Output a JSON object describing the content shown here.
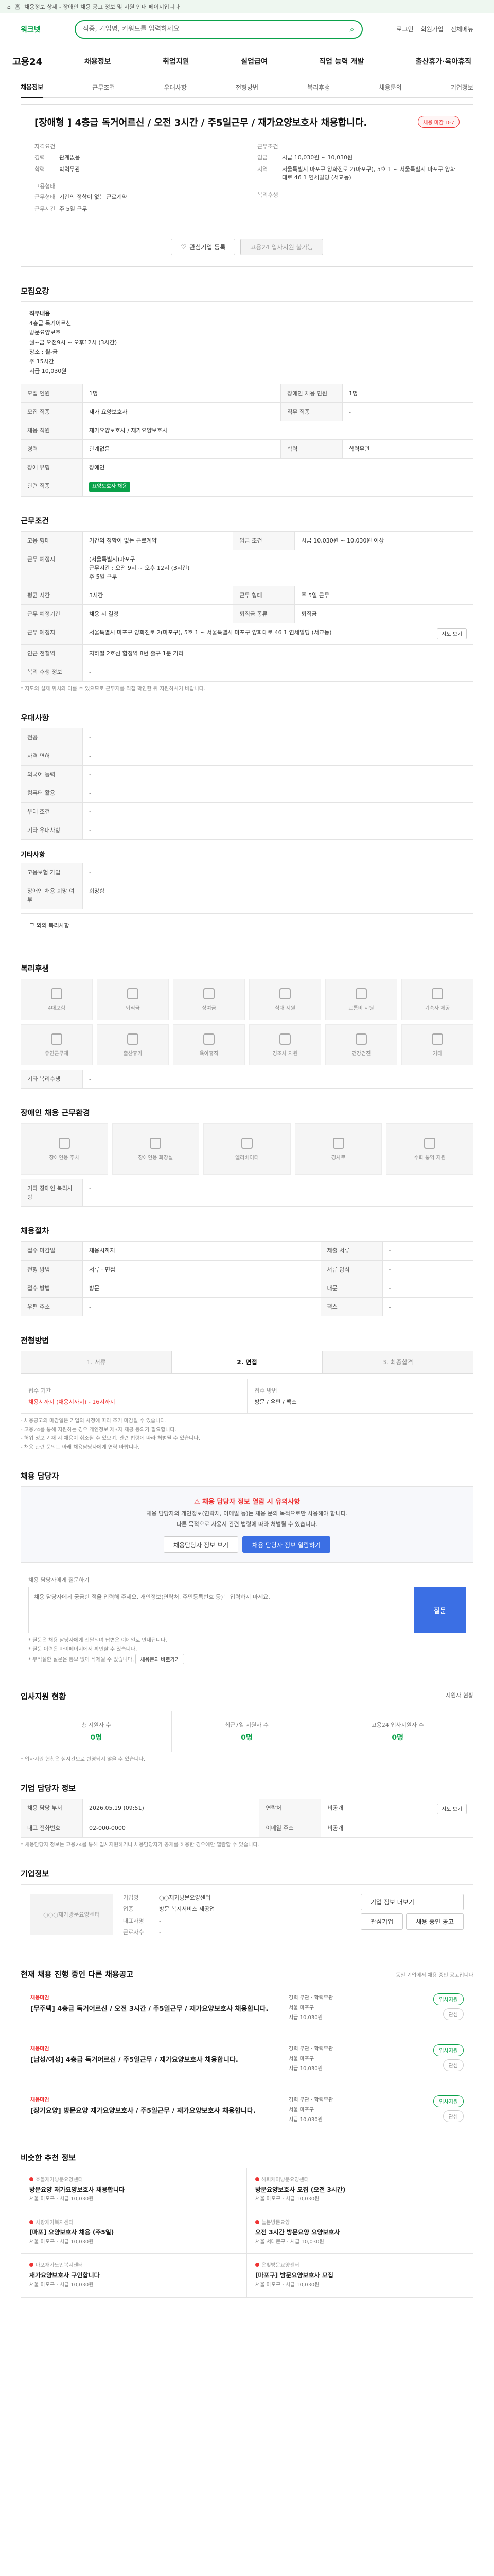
{
  "topstrip": {
    "home": "홈",
    "text": "채용정보 상세 - 장애인 채용 공고 정보 및 지원 안내 페이지입니다"
  },
  "header": {
    "logo": "워크넷",
    "search_placeholder": "직종, 기업명, 키워드를 입력하세요",
    "login": "로그인",
    "join": "회원가입",
    "menu_all": "전체메뉴"
  },
  "gnb": {
    "brand": "고용24",
    "items": [
      "채용정보",
      "취업지원",
      "실업급여",
      "직업 능력 개발",
      "출산휴가·육아휴직"
    ]
  },
  "tabs": {
    "items": [
      "채용정보",
      "근무조건",
      "우대사항",
      "전형방법",
      "복리후생",
      "채용문의",
      "기업정보"
    ]
  },
  "summary": {
    "title": "[장애형 ] 4층급 독거어르신 / 오전 3시간 / 주5일근무 / 재가요양보호사 채용합니다.",
    "badge": "채용 마감 D-7",
    "left_label": "자격요건",
    "left": [
      {
        "k": "경력",
        "v": "관계없음"
      },
      {
        "k": "학력",
        "v": "학력무관"
      }
    ],
    "left_label2": "고용형태",
    "left2": [
      {
        "k": "근무형태",
        "v": "기간의 정함이 없는 근로계약"
      },
      {
        "k": "근무시간",
        "v": "주 5일 근무"
      }
    ],
    "right_label": "근무조건",
    "right": [
      {
        "k": "임금",
        "v": "시급 10,030원 ~ 10,030원"
      },
      {
        "k": "지역",
        "v": "서울특별시 마포구 양화진로 2(마포구), 5호 1 ~ 서울특별시 마포구 양화대로 46 1 연세빌딩 (서교동)"
      }
    ],
    "right_label2": "복리후생",
    "btn_interest": "관심기업 등록",
    "btn_apply": "고용24 입사지원 불가능"
  },
  "recruit": {
    "h": "모집요강",
    "duty_label": "직무내용",
    "duty": "4층급 독거어르신\n방문요양보호\n월~금 오전9시 ~ 오후12시 (3시간)\n장소 : 월-금\n주 15시간\n시급 10,030원",
    "rows": [
      {
        "k1": "모집 인원",
        "v1": "1명",
        "k2": "장애인 채용 인원",
        "v2": "1명"
      },
      {
        "k1": "모집 직종",
        "v1": "재가 요양보호사",
        "k2": "직무 직종",
        "v2": "-"
      },
      {
        "k1": "채용 직원",
        "v1": "재가요양보호사 / 재가요양보호사",
        "k2": "",
        "v2": ""
      },
      {
        "k1": "경력",
        "v1": "관계없음",
        "k2": "학력",
        "v2": "학력무관"
      },
      {
        "k1": "장애 유형",
        "v1": "장애인",
        "k2": "",
        "v2": ""
      }
    ],
    "keyword_label": "관련 직종",
    "keyword": "요양보호사 채용"
  },
  "work": {
    "h": "근무조건",
    "rows": [
      {
        "k1": "고용 형태",
        "v1": "기간의 정함이 없는 근로계약",
        "k2": "임금 조건",
        "v2": "시급 10,030원 ~ 10,030원 이상"
      },
      {
        "k1": "근무 예정지",
        "v1": "(서울특별시)마포구\n근무시간 : 오전 9시 ~ 오후 12시 (3시간)\n주 5일 근무",
        "k2": "",
        "v2": ""
      },
      {
        "k1": "평균 시간",
        "v1": "3시간",
        "k2": "근무 형태",
        "v2": "주 5일 근무"
      },
      {
        "k1": "근무 예정기간",
        "v1": "채용 시 결정",
        "k2": "퇴직금 종류",
        "v2": "퇴직금"
      },
      {
        "k1": "근무 예정지",
        "v1": "서울특별시 마포구 양화진로 2(마포구), 5호 1 ~ 서울특별시 마포구 양화대로 46 1 연세빌딩 (서교동)",
        "k2": "",
        "v2": ""
      },
      {
        "k1": "인근 전철역",
        "v1": "지하철 2호선 합정역 8번 출구 1분 거리",
        "k2": "",
        "v2": ""
      },
      {
        "k1": "복리 후생 정보",
        "v1": "-",
        "k2": "",
        "v2": ""
      }
    ],
    "map_btn": "지도 보기",
    "note": "* 지도의 실제 위치와 다를 수 있으므로 근무지를 직접 확인한 뒤 지원하시기 바랍니다."
  },
  "prefer": {
    "h": "우대사항",
    "rows": [
      {
        "k": "전공",
        "v": "-"
      },
      {
        "k": "자격 면허",
        "v": "-"
      },
      {
        "k": "외국어 능력",
        "v": "-"
      },
      {
        "k": "컴퓨터 활용",
        "v": "-"
      },
      {
        "k": "우대 조건",
        "v": "-"
      },
      {
        "k": "기타 우대사항",
        "v": "-"
      }
    ],
    "etc_h": "기타사항",
    "etc": [
      {
        "k": "고용보험 가입",
        "v": "-"
      },
      {
        "k": "장애인 채용 희망 여부",
        "v": "희망함"
      }
    ],
    "etc_box": "그 외의 복리사항"
  },
  "welfare": {
    "h": "복리후생",
    "items": [
      "4대보험",
      "퇴직금",
      "상여금",
      "식대 지원",
      "교통비 지원",
      "기숙사 제공",
      "유연근무제",
      "출산휴가",
      "육아휴직",
      "경조사 지원",
      "건강검진",
      "기타"
    ],
    "etc_label": "기타 복리후생",
    "etc": "-"
  },
  "disability": {
    "h": "장애인 채용 근무환경",
    "items": [
      "장애인용 주차",
      "장애인용 화장실",
      "엘리베이터",
      "경사로",
      "수화 통역 지원"
    ],
    "etc_label": "기타 장애인 복리사항",
    "etc": "-"
  },
  "apply": {
    "h": "채용절차",
    "rows": [
      {
        "k1": "접수 마감일",
        "v1": "채용시까지",
        "k2": "제출 서류",
        "v2": "-"
      },
      {
        "k1": "전형 방법",
        "v1": "서류 · 면접",
        "k2": "서류 양식",
        "v2": "-"
      },
      {
        "k1": "접수 방법",
        "v1": "방문",
        "k2": "내문",
        "v2": "-"
      },
      {
        "k1": "우편 주소",
        "v1": "-",
        "k2": "팩스",
        "v2": "-"
      }
    ]
  },
  "process": {
    "h": "전형방법",
    "steps": [
      "1. 서류",
      "2. 면접",
      "3. 최종합격"
    ],
    "left_label": "접수 기간",
    "left_status": "채용시까지 (채용시까지) - 16시까지",
    "right_label": "접수 방법",
    "right_v": "방문 / 우편 / 팩스",
    "notes": [
      "- 채용공고의 마감일은 기업의 사정에 따라 조기 마감될 수 있습니다.",
      "- 고용24를 통해 지원하는 경우 개인정보 제3자 제공 동의가 필요합니다.",
      "- 허위 정보 기재 시 채용이 취소될 수 있으며, 관련 법령에 따라 처벌될 수 있습니다.",
      "- 채용 관련 문의는 아래 채용담당자에게 연락 바랍니다."
    ]
  },
  "inquiry": {
    "h": "채용 담당자",
    "warn": "채용 담당자 정보 열람 시 유의사항",
    "body": "채용 담당자의 개인정보(연락처, 이메일 등)는 채용 문의 목적으로만 사용해야 합니다.\n다른 목적으로 사용시 관련 법령에 따라 처벌될 수 있습니다.",
    "btn1": "채용담당자 정보 보기",
    "btn2": "채용 담당자 정보 열람하기",
    "form_label": "채용 담당자에게 질문하기",
    "form_placeholder": "채용 담당자에게 궁금한 점을 입력해 주세요. 개인정보(연락처, 주민등록번호 등)는 입력하지 마세요.",
    "send": "질문",
    "n1": "* 질문은 채용 담당자에게 전달되며 답변은 이메일로 안내됩니다.",
    "n2": "* 질문 이력은 마이페이지에서 확인할 수 있습니다.",
    "n3": "* 부적절한 질문은 통보 없이 삭제될 수 있습니다.",
    "inq_btn": "채용문의 바로가기"
  },
  "status": {
    "h": "입사지원 현황",
    "more": "지원자 현황",
    "items": [
      {
        "k": "총 지원자 수",
        "v": "0명"
      },
      {
        "k": "최근7일 지원자 수",
        "v": "0명"
      },
      {
        "k": "고용24 입사지원자 수",
        "v": "0명"
      }
    ],
    "note": "* 입사지원 현황은 실시간으로 반영되지 않을 수 있습니다."
  },
  "manager": {
    "h": "기업 담당자 정보",
    "rows": [
      {
        "k1": "채용 담당 부서",
        "v1": "2026.05.19 (09:51)",
        "k2": "연락처",
        "v2": "비공개"
      },
      {
        "k1": "대표 전화번호",
        "v1": "02-000-0000",
        "k2": "이메일 주소",
        "v2": "비공개"
      }
    ],
    "btn": "지도 보기",
    "note": "* 채용담당자 정보는 고용24를 통해 입사지원하거나 채용담당자가 공개를 허용한 경우에만 열람할 수 있습니다."
  },
  "company": {
    "h": "기업정보",
    "name": "○○○재가방문요양센터",
    "rows": [
      {
        "k": "기업명",
        "v": "○○재가방문요양센터"
      },
      {
        "k": "업종",
        "v": "방문 복지서비스 제공업"
      },
      {
        "k": "대표자명",
        "v": "-"
      },
      {
        "k": "근로자수",
        "v": "-"
      }
    ],
    "btn_more": "기업 정보 더보기",
    "btn_follow": "관심기업",
    "btn_jobs": "채용 중인 공고"
  },
  "joblist": {
    "h": "현재 채용 진행 중인 다른 채용공고",
    "note": "동일 기업에서 채용 중인 공고입니다",
    "items": [
      {
        "co": "채용마감",
        "t": "[무주택] 4층급 독거어르신 / 오전 3시간 / 주5일근무 / 재가요양보호사 채용합니다.",
        "m1": "경력 무관 · 학력무관",
        "m2": "서울 마포구",
        "m3": "시급 10,030원",
        "p1": "입사지원",
        "p2": "관심"
      },
      {
        "co": "채용마감",
        "t": "[남성/여성] 4층급 독거어르신 / 주5일근무 / 재가요양보호사 채용합니다.",
        "m1": "경력 무관 · 학력무관",
        "m2": "서울 마포구",
        "m3": "시급 10,030원",
        "p1": "입사지원",
        "p2": "관심"
      },
      {
        "co": "채용마감",
        "t": "[장기요양] 방문요양 재가요양보호사 / 주5일근무 / 재가요양보호사 채용합니다.",
        "m1": "경력 무관 · 학력무관",
        "m2": "서울 마포구",
        "m3": "시급 10,030원",
        "p1": "입사지원",
        "p2": "관심"
      }
    ]
  },
  "recommend": {
    "h": "비슷한 추천 정보",
    "items": [
      {
        "co": "효돌재가방문요양센터",
        "t": "방문요양 재가요양보호사 채용합니다",
        "d": "서울 마포구 · 시급 10,030원"
      },
      {
        "co": "해피케어방문요양센터",
        "t": "방문요양보호사 모집 (오전 3시간)",
        "d": "서울 마포구 · 시급 10,030원"
      },
      {
        "co": "사랑재가복지센터",
        "t": "[마포] 요양보호사 채용 (주5일)",
        "d": "서울 마포구 · 시급 10,030원"
      },
      {
        "co": "늘봄방문요양",
        "t": "오전 3시간 방문요양 요양보호사",
        "d": "서울 서대문구 · 시급 10,030원"
      },
      {
        "co": "마포재가노인복지센터",
        "t": "재가요양보호사 구인합니다",
        "d": "서울 마포구 · 시급 10,030원"
      },
      {
        "co": "은빛방문요양센터",
        "t": "[마포구] 방문요양보호사 모집",
        "d": "서울 마포구 · 시급 10,030원"
      }
    ]
  }
}
